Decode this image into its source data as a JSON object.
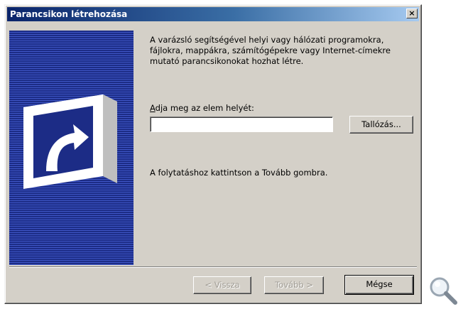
{
  "window": {
    "title": "Parancsikon létrehozása",
    "close_label": "×"
  },
  "main": {
    "description": "A varázsló segítségével helyi vagy hálózati programokra, fájlokra, mappákra, számítógépekre vagy Internet-címekre mutató parancsikonokat hozhat létre.",
    "location_label_accel": "A",
    "location_label_rest": "dja meg az elem helyét:",
    "location_value": "",
    "browse_label": "Tallózás...",
    "hint": "A folytatáshoz kattintson a Tovább gombra."
  },
  "footer": {
    "back_label": "< Vissza",
    "next_label": "Tovább >",
    "cancel_label": "Mégse"
  },
  "icons": {
    "wizard_icon": "shortcut-arrow-icon",
    "zoom_icon": "magnifier-icon"
  },
  "colors": {
    "titlebar_start": "#0a246a",
    "titlebar_end": "#a6caf0",
    "side_panel": "#1c2c86",
    "dialog_bg": "#d4d0c8"
  }
}
